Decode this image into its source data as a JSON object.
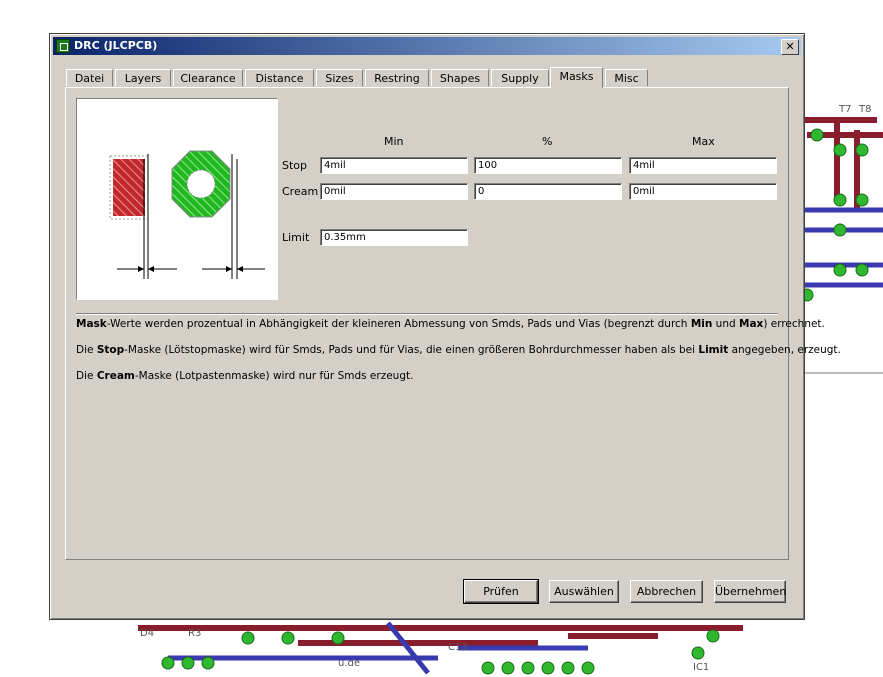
{
  "window": {
    "title": "DRC (JLCPCB)",
    "close_label": "✕"
  },
  "tabs": [
    {
      "label": "Datei"
    },
    {
      "label": "Layers"
    },
    {
      "label": "Clearance"
    },
    {
      "label": "Distance"
    },
    {
      "label": "Sizes"
    },
    {
      "label": "Restring"
    },
    {
      "label": "Shapes"
    },
    {
      "label": "Supply"
    },
    {
      "label": "Masks"
    },
    {
      "label": "Misc"
    }
  ],
  "active_tab": "Masks",
  "masks": {
    "headers": {
      "min": "Min",
      "percent": "%",
      "max": "Max"
    },
    "stop": {
      "label": "Stop",
      "min": "4mil",
      "percent": "100",
      "max": "4mil"
    },
    "cream": {
      "label": "Cream",
      "min": "0mil",
      "percent": "0",
      "max": "0mil"
    },
    "limit": {
      "label": "Limit",
      "value": "0.35mm"
    }
  },
  "description": {
    "line1": {
      "b1": "Mask",
      "t1": "-Werte werden prozentual in Abhängigkeit der kleineren Abmessung von Smds, Pads und Vias (begrenzt durch ",
      "b2": "Min",
      "t2": " und ",
      "b3": "Max",
      "t3": ") errechnet."
    },
    "line2": {
      "t0": "Die ",
      "b1": "Stop",
      "t1": "-Maske (Lötstopmaske) wird für Smds, Pads und für Vias, die einen größeren Bohrdurchmesser haben als bei ",
      "b2": "Limit",
      "t2": " angegeben, erzeugt."
    },
    "line3": {
      "t0": "Die ",
      "b1": "Cream",
      "t1": "-Maske (Lotpastenmaske) wird nur für Smds erzeugt."
    }
  },
  "buttons": {
    "check": "Prüfen",
    "select": "Auswählen",
    "cancel": "Abbrechen",
    "apply": "Übernehmen"
  },
  "background_labels": {
    "t7": "T7",
    "t8": "T8",
    "d4": "D4",
    "r3": "R3",
    "c13": "C13",
    "url": "u.de",
    "ic1": "IC1"
  },
  "colors": {
    "pad_green": "#1fb81f",
    "smd_red": "#c0292b",
    "title_blue": "#0a246a",
    "dialog_gray": "#d4d0c8"
  }
}
